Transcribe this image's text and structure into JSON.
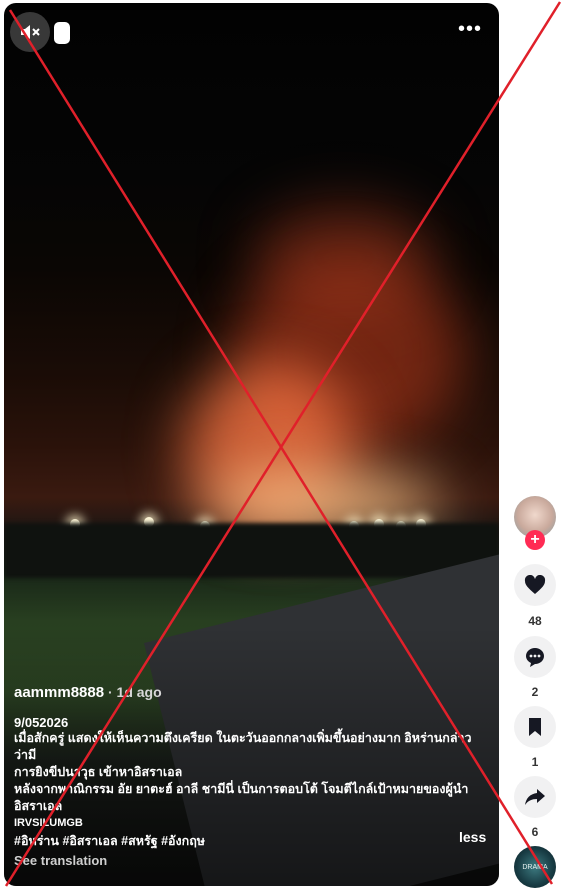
{
  "controls": {
    "mute_icon": "speaker-muted-icon",
    "more_icon": "more-dots-icon",
    "more_label": "•••"
  },
  "post": {
    "username": "aammm8888",
    "separator": " · ",
    "age": "1d ago",
    "date": "9/052026",
    "line1": "เมื่อสักครู่ แสดงให้เห็นความตึงเครียด ในตะวันออกกลางเพิ่มขึ้นอย่างมาก อิหร่านกล่าวว่ามี",
    "line2": "การยิงขีปนาวุธ เข้าหาอิสราเอล",
    "line3": "หลังจากพาณิกรรม อัย ยาตะฮ์ อาลี ชามีนี่ เป็นการตอบโต้ โจมตีไกล์เป้าหมายของผู้นำ",
    "line4": "อิสราเอล",
    "code": "IRVSILUMGB",
    "hashtags": "#อิหร่าน #อิสราเอล #สหรัฐ #อังกฤษ",
    "less_label": "less",
    "see_translation": "See translation"
  },
  "actions": {
    "follow_plus": "+",
    "likes": "48",
    "comments": "2",
    "saves": "1",
    "shares": "6",
    "music_label": "DRAMA"
  },
  "colors": {
    "cross": "#e0202a",
    "follow": "#ff2b54",
    "action_bg": "#f1f1f2"
  }
}
